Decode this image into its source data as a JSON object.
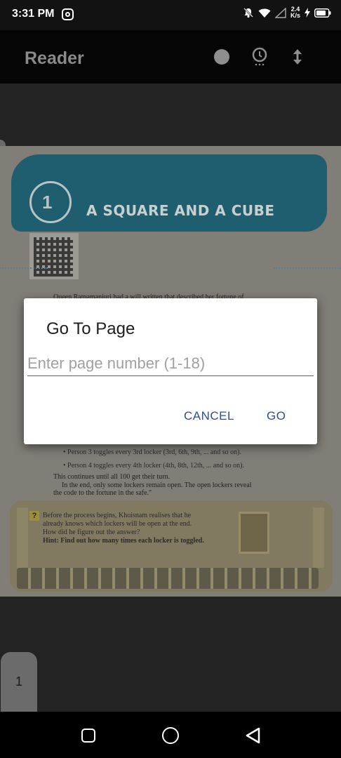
{
  "status_bar": {
    "time": "3:31 PM",
    "net_speed_value": "2.4",
    "net_speed_unit": "K/s",
    "icons": [
      "instagram-icon",
      "mute-bell-icon",
      "wifi-icon",
      "signal-icon",
      "charging-icon",
      "battery-icon"
    ]
  },
  "app_bar": {
    "title": "Reader",
    "icons": [
      "dot-icon",
      "bulb-icon",
      "up-down-arrow-icon"
    ]
  },
  "page": {
    "chapter_number": "1",
    "chapter_title": "A SQUARE AND A CUBE",
    "text_lines": [
      "Queen Ratnamanjuri had a will written that described her fortune of",
      "• Person 3 toggles every 3rd locker (3rd, 6th, 9th, ... and so on).",
      "• Person 4 toggles every 4th locker (4th, 8th, 12th, ... and so on).",
      "This continues until all 100 get their turn.",
      "In the end, only some lockers remain open. The open lockers reveal",
      "the code to the fortune in the safe.\""
    ],
    "hint_lines": [
      "Before the process begins, Khoisnam realises that he",
      "already knows which lockers will be open at the end.",
      "How did he figure out the answer?",
      "Hint: Find out how many times each locker is toggled."
    ],
    "hint_marker": "?"
  },
  "page_indicator": "1",
  "dialog": {
    "title": "Go To Page",
    "input_placeholder": "Enter page number (1-18)",
    "input_value": "",
    "cancel_label": "CANCEL",
    "go_label": "GO"
  },
  "colors": {
    "accent": "#2b4e94",
    "input_underline": "#4a5aa8"
  }
}
